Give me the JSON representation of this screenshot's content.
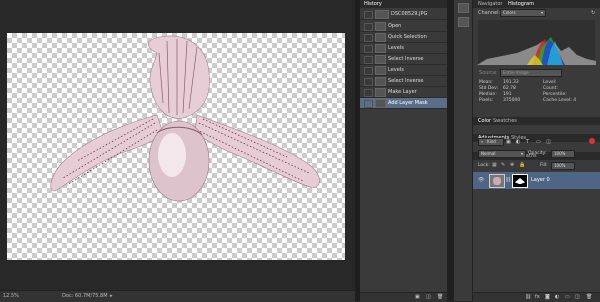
{
  "canvas": {
    "subject": "white-pink striped orchid flower on transparent background"
  },
  "status_bar": {
    "zoom": "12.5%",
    "doc": "Doc: 60.7M/75.8M"
  },
  "history": {
    "tab": "History",
    "snapshot": "DSC08529.JPG",
    "items": [
      "Open",
      "Quick Selection",
      "Levels",
      "Select Inverse",
      "Levels",
      "Select Inverse",
      "Make Layer",
      "Add Layer Mask"
    ]
  },
  "navigator": {
    "tabs": [
      "Navigator",
      "Histogram"
    ],
    "channel_label": "Channel:",
    "channel_value": "Colors",
    "source_label": "Source:",
    "source_value": "Entire Image",
    "stats_left": [
      {
        "label": "Mean:",
        "value": "191.33"
      },
      {
        "label": "Std Dev:",
        "value": "62.78"
      },
      {
        "label": "Median:",
        "value": "191"
      },
      {
        "label": "Pixels:",
        "value": "375000"
      }
    ],
    "stats_right": [
      {
        "label": "Level:",
        "value": ""
      },
      {
        "label": "Count:",
        "value": ""
      },
      {
        "label": "Percentile:",
        "value": ""
      },
      {
        "label": "Cache Level:",
        "value": "4"
      }
    ]
  },
  "color_panel": {
    "tabs": [
      "Color",
      "Swatches"
    ]
  },
  "adjust_panel": {
    "tabs": [
      "Adjustments",
      "Styles"
    ]
  },
  "layers": {
    "tabs": [
      "Layers",
      "Channels",
      "Paths"
    ],
    "kind_label": "Kind",
    "blend_mode": "Normal",
    "opacity_label": "Opacity:",
    "opacity_value": "100%",
    "lock_label": "Lock:",
    "fill_label": "Fill:",
    "fill_value": "100%",
    "layer_name": "Layer 0"
  },
  "colors": {
    "selected_row": "#5a6e8a",
    "layer_selected": "#4f6585"
  }
}
